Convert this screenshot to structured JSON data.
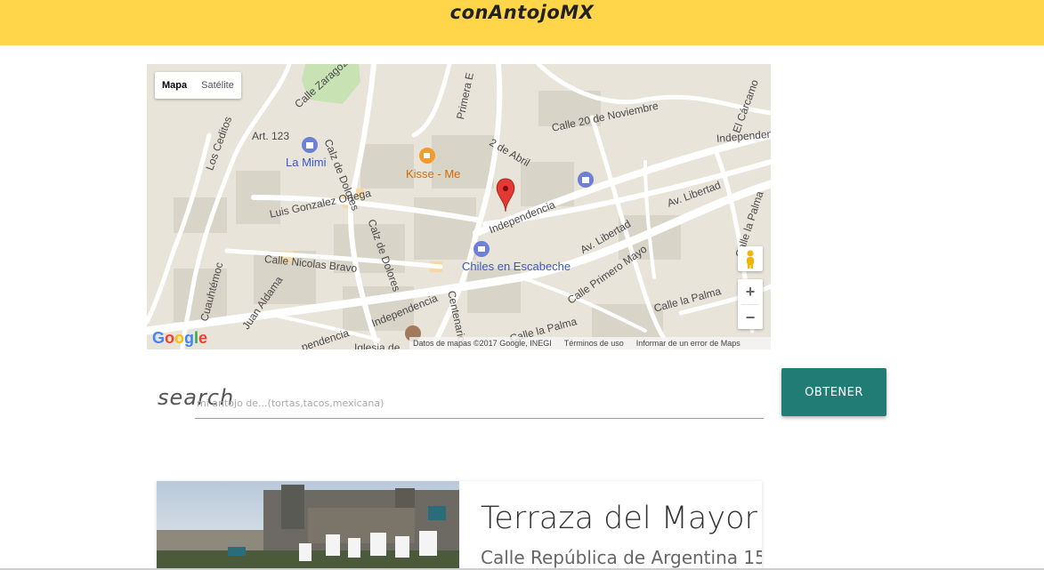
{
  "header": {
    "brand": "conAntojoMX",
    "background_color": "#ffd54a"
  },
  "map": {
    "map_types": {
      "map": "Mapa",
      "satellite": "Satélite",
      "selected": "Mapa"
    },
    "pois": [
      {
        "name": "La Mimi",
        "category": "shopping"
      },
      {
        "name": "Kisse - Me",
        "category": "cafe"
      },
      {
        "name": "Chiles en Escabeche",
        "category": "shopping"
      }
    ],
    "streets": {
      "s1": "Calle Zaragoza",
      "s2": "Primera E",
      "s3": "Calle 20 de Noviembre",
      "s4": "El Cárcamo",
      "s5": "Art. 123",
      "s6": "Los Ceditos",
      "s7": "Calz de Dolores",
      "s8": "2 de Abril",
      "s9": "Independencia",
      "s10": "Av. Libertad",
      "s11": "Luis Gonzalez Ortega",
      "s12": "Calz de Dolores",
      "s13": "Independencia",
      "s14": "Av. Libertad",
      "s15": "Calle la Palma",
      "s16": "Calle Nicolas Bravo",
      "s17": "Calle Primero Mayo",
      "s18": "Cuauhtémoc",
      "s19": "Independencia",
      "s20": "Centenario",
      "s21": "Juan Aldama",
      "s22": "Calle la Palma",
      "s23": "Calle la Palma",
      "s24": "Iglesia de",
      "s25": "pendencia"
    },
    "zoom_in": "+",
    "zoom_out": "−",
    "google_logo": "Google",
    "attribution": {
      "data": "Datos de mapas ©2017 Google, INEGI",
      "terms": "Términos de uso",
      "report": "Informar de un error de Maps"
    }
  },
  "search": {
    "label": "search",
    "placeholder": "mi antojo de...(tortas,tacos,mexicana)",
    "value": "",
    "button_label": "OBTENER",
    "button_color": "#207c74"
  },
  "results": [
    {
      "title": "Terraza del Mayor",
      "address": "Calle República de Argentina 15"
    }
  ]
}
